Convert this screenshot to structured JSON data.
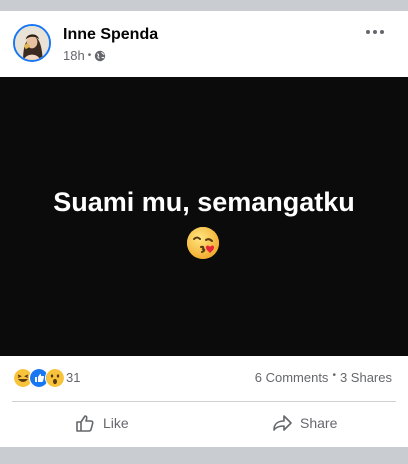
{
  "post": {
    "author": "Inne Spenda",
    "time": "18h",
    "separator": "•",
    "audience_icon": "globe-icon",
    "text": "Suami mu, semangatku",
    "text_emoji": "face-blowing-kiss"
  },
  "stats": {
    "reactions": [
      "haha",
      "like",
      "wow"
    ],
    "reaction_count": "31",
    "comments": "6 Comments",
    "shares": "3 Shares",
    "separator": "•"
  },
  "actions": {
    "like_label": "Like",
    "share_label": "Share"
  },
  "colors": {
    "background": "#c9ccd1",
    "card": "#ffffff",
    "post_bg": "#0b0b0b",
    "accent": "#1877f2",
    "muted_text": "#65676b"
  }
}
